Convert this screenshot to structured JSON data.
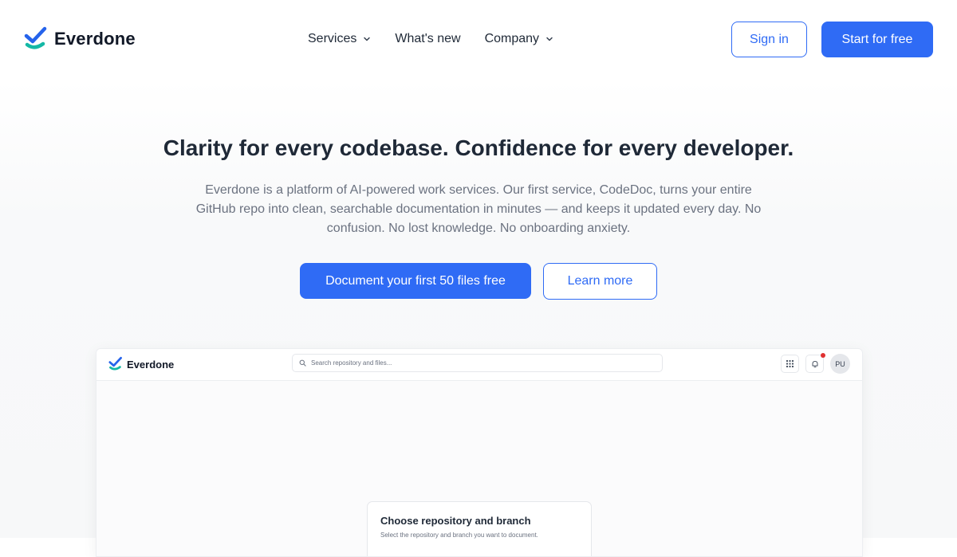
{
  "brand": {
    "name": "Everdone"
  },
  "nav": {
    "links": [
      {
        "label": "Services",
        "has_dropdown": true
      },
      {
        "label": "What's new",
        "has_dropdown": false
      },
      {
        "label": "Company",
        "has_dropdown": true
      }
    ],
    "sign_in": "Sign in",
    "start_free": "Start for free"
  },
  "hero": {
    "title": "Clarity for every codebase. Confidence for every developer.",
    "text_line1": "Everdone is a platform of AI-powered work services. Our first service, CodeDoc, turns your entire",
    "text_line2": "GitHub repo into clean, searchable documentation in minutes — and keeps it updated every day. No",
    "text_line3": "confusion. No lost knowledge. No onboarding anxiety.",
    "primary_cta": "Document your first 50 files free",
    "secondary_cta": "Learn more"
  },
  "preview": {
    "brand_name": "Everdone",
    "search_placeholder": "Search repository and files...",
    "avatar_initials": "PU",
    "card_title": "Choose repository and branch",
    "card_subtitle": "Select the repository and branch you want to document."
  },
  "colors": {
    "accent": "#2f6bf5",
    "logo_dark": "#2563eb",
    "logo_teal": "#14b8a6",
    "notification": "#e03131"
  },
  "icons": [
    "check-logo-icon",
    "chevron-down-icon",
    "search-icon",
    "grid-icon",
    "bell-icon"
  ]
}
